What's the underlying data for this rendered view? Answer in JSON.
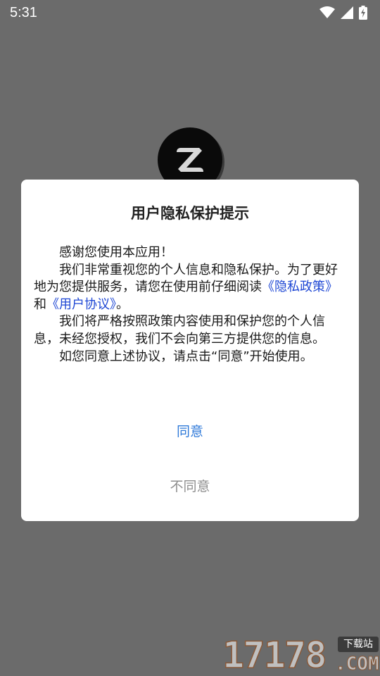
{
  "status_bar": {
    "time": "5:31",
    "icons": [
      "wifi-icon",
      "signal-icon",
      "battery-charging-icon"
    ]
  },
  "dialog": {
    "title": "用户隐私保护提示",
    "greeting": "感谢您使用本应用！",
    "para1_text": "我们非常重视您的个人信息和隐私保护。为了更好地为您提供服务，请您在使用前仔细阅读",
    "privacy_link": "《隐私政策》",
    "and_text": "和",
    "user_agreement_link": "《用户协议》",
    "para1_end": "。",
    "para2": "我们将严格按照政策内容使用和保护您的个人信息，未经您授权，我们不会向第三方提供您的信息。",
    "para3": "如您同意上述协议，请点击“同意”开始使用。",
    "agree_label": "同意",
    "disagree_label": "不同意"
  },
  "watermark": {
    "number": "17178",
    "badge": "下载站",
    "domain": ".COM"
  },
  "colors": {
    "overlay": "#6b6b6b",
    "link": "#1e47d4",
    "agree": "#2f7ad9",
    "disagree": "#8e8e8e"
  }
}
